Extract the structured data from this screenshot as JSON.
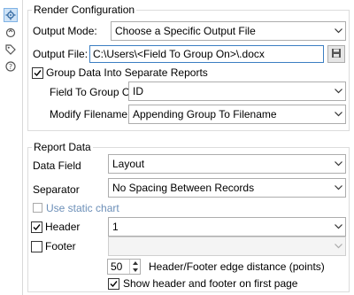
{
  "sidebar": {
    "icons": [
      {
        "name": "gear-icon"
      },
      {
        "name": "refresh-icon"
      },
      {
        "name": "tag-icon"
      },
      {
        "name": "help-icon"
      }
    ]
  },
  "render_config": {
    "title": "Render Configuration",
    "output_mode_label": "Output Mode:",
    "output_mode_value": "Choose a Specific Output File",
    "output_file_label": "Output File:",
    "output_file_value": "C:\\Users\\<Field To Group On>\\.docx",
    "group_data_label": "Group Data Into Separate Reports",
    "group_data_checked": true,
    "field_to_group_label": "Field To Group On:",
    "field_to_group_value": "ID",
    "modify_filename_label": "Modify Filename By:",
    "modify_filename_value": "Appending Group To Filename"
  },
  "report_data": {
    "title": "Report Data",
    "data_field_label": "Data Field",
    "data_field_value": "Layout",
    "separator_label": "Separator",
    "separator_value": "No Spacing Between Records",
    "static_chart_label": "Use static chart",
    "static_chart_checked": false,
    "header_label": "Header",
    "header_checked": true,
    "header_value": "1",
    "footer_label": "Footer",
    "footer_checked": false,
    "footer_value": "",
    "edge_distance_value": "50",
    "edge_distance_label": "Header/Footer edge distance (points)",
    "show_first_page_label": "Show header and footer on first page",
    "show_first_page_checked": true
  },
  "colors": {
    "accent": "#3c7fc2",
    "disabled_text": "#6c8fb8"
  }
}
